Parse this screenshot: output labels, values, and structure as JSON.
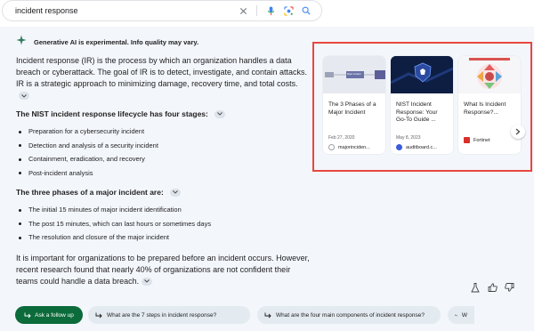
{
  "search": {
    "query": "incident response"
  },
  "overview": {
    "notice": "Generative AI is experimental. Info quality may vary.",
    "intro": "Incident response (IR) is the process by which an organization handles a data breach or cyberattack. The goal of IR is to detect, investigate, and contain attacks. IR is a strategic approach to minimizing damage, recovery time, and total costs.",
    "lifecycle_heading": "The NIST incident response lifecycle has four stages:",
    "lifecycle_items": [
      "Preparation for a cybersecurity incident",
      "Detection and analysis of a security incident",
      "Containment, eradication, and recovery",
      "Post-incident analysis"
    ],
    "phases_heading": "The three phases of a major incident are:",
    "phases_items": [
      "The initial 15 minutes of major incident identification",
      "The post 15 minutes, which can last hours or sometimes days",
      "The resolution and closure of the major incident"
    ],
    "closing": "It is important for organizations to be prepared before an incident occurs. However, recent research found that nearly 40% of organizations are not confident their teams could handle a data breach."
  },
  "sources": [
    {
      "title": "The 3 Phases of a Major Incident",
      "date": "Feb 27, 2020",
      "site": "majorinciden...",
      "thumb_text": "Major Incident"
    },
    {
      "title": "NIST Incident Response: Your Go-To Guide ...",
      "date": "May 8, 2023",
      "site": "auditboard.c..."
    },
    {
      "title": "What Is Incident Response?...",
      "date": "",
      "site": "Fortinet"
    }
  ],
  "followups": {
    "ask_label": "Ask a follow up",
    "suggestions": [
      "What are the 7 steps in incident response?",
      "What are the four main components of incident response?",
      "W"
    ]
  },
  "colors": {
    "highlight_border": "#e8473f",
    "ask_button": "#0b6b3a",
    "panel_bg": "#f3f6fb"
  }
}
